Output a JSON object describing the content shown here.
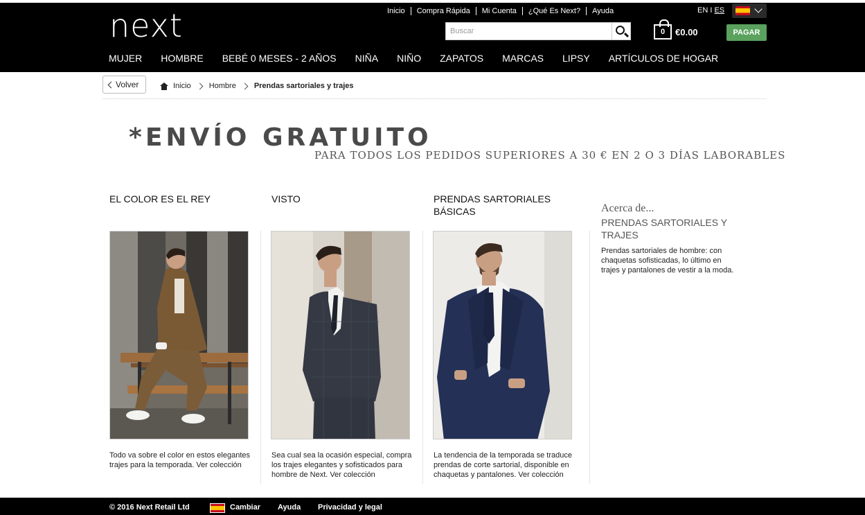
{
  "header": {
    "logo": "next",
    "top_links": [
      "Inicio",
      "Compra Rápida",
      "Mi Cuenta",
      "¿Qué Es Next?",
      "Ayuda"
    ],
    "lang_en": "EN",
    "lang_sep": "I",
    "lang_es": "ES",
    "search_placeholder": "Buscar",
    "bag_count": "0",
    "bag_total": "€0.00",
    "checkout_label": "PAGAR"
  },
  "nav": [
    "MUJER",
    "HOMBRE",
    "BEBÉ 0 MESES - 2 AÑOS",
    "NIÑA",
    "NIÑO",
    "ZAPATOS",
    "MARCAS",
    "LIPSY",
    "ARTÍCULOS DE HOGAR"
  ],
  "breadcrumb": {
    "back_label": "Volver",
    "items": [
      "Inicio",
      "Hombre",
      "Prendas sartoriales y trajes"
    ]
  },
  "banner": {
    "headline": "*ENVÍO GRATUITO",
    "subline": "PARA TODOS LOS PEDIDOS SUPERIORES A 30 € EN 2 O 3 DÍAS LABORABLES"
  },
  "columns": [
    {
      "title": "EL COLOR ES EL REY",
      "description": "Todo va sobre el color en estos elegantes trajes para la temporada. Ver colección"
    },
    {
      "title": "VISTO",
      "description": "Sea cual sea la ocasión especial, compra los trajes elegantes y sofisticados para hombre de Next. Ver colección"
    },
    {
      "title": "PRENDAS SARTORIALES BÁSICAS",
      "description": "La tendencia de la temporada se traduce prendas de corte sartorial, disponible en chaquetas y pantalones. Ver colección"
    }
  ],
  "about": {
    "kicker": "Acerca de...",
    "title": "PRENDAS SARTORIALES Y TRAJES",
    "text": "Prendas sartoriales de hombre: con chaquetas sofisticadas, lo último en trajes y pantalones de vestir a la moda."
  },
  "footer": {
    "copyright": "© 2016 Next Retail Ltd",
    "change": "Cambiar",
    "help": "Ayuda",
    "privacy": "Privacidad y legal"
  },
  "colors": {
    "header_bg": "#000000",
    "checkout_green": "#5aa25e",
    "banner_grey": "#4a4a4a"
  }
}
